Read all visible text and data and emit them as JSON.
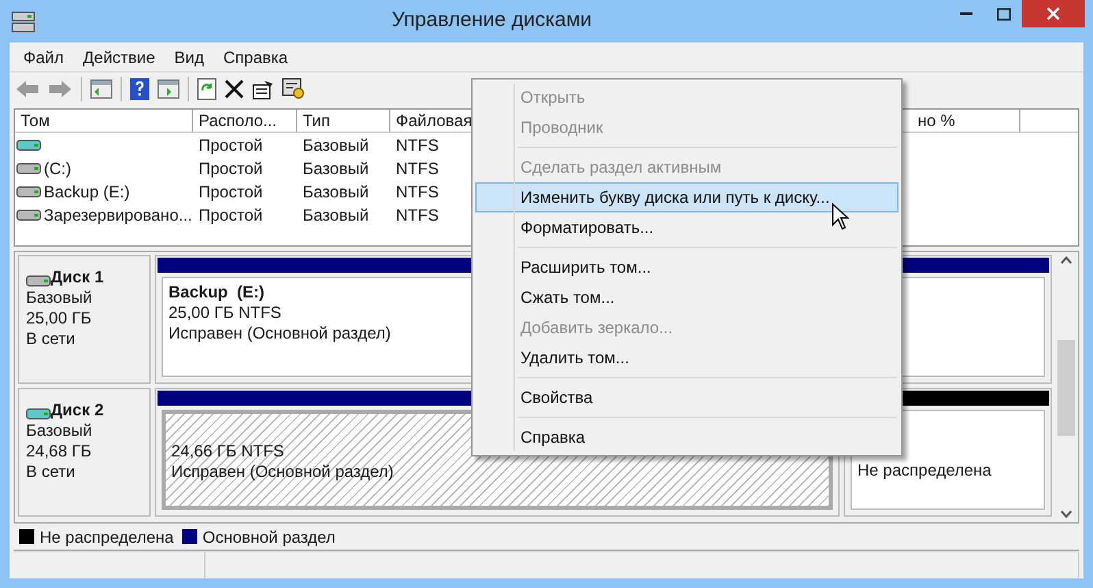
{
  "window": {
    "title": "Управление дисками"
  },
  "menu_bar": [
    "Файл",
    "Действие",
    "Вид",
    "Справка"
  ],
  "table": {
    "columns": [
      "Том",
      "Располо...",
      "Тип",
      "Файловая",
      "но %"
    ],
    "rows": [
      {
        "volume": "",
        "layout": "Простой",
        "type": "Базовый",
        "fs": "NTFS"
      },
      {
        "volume": "(C:)",
        "layout": "Простой",
        "type": "Базовый",
        "fs": "NTFS"
      },
      {
        "volume": "Backup (E:)",
        "layout": "Простой",
        "type": "Базовый",
        "fs": "NTFS"
      },
      {
        "volume": "Зарезервировано...",
        "layout": "Простой",
        "type": "Базовый",
        "fs": "NTFS"
      }
    ]
  },
  "disks": [
    {
      "name": "Диск 1",
      "type": "Базовый",
      "size": "25,00 ГБ",
      "status": "В сети",
      "partitions": [
        {
          "kind": "primary",
          "title": "Backup  (E:)",
          "size": "25,00 ГБ NTFS",
          "state": "Исправен (Основной раздел)",
          "selected": false
        }
      ]
    },
    {
      "name": "Диск 2",
      "type": "Базовый",
      "size": "24,68 ГБ",
      "status": "В сети",
      "partitions": [
        {
          "kind": "primary",
          "size": "24,66 ГБ NTFS",
          "state": "Исправен (Основной раздел)",
          "selected": true
        },
        {
          "kind": "unallocated",
          "state": "Не распределена",
          "selected": false
        }
      ]
    }
  ],
  "legend": [
    {
      "label": "Не распределена",
      "color": "#000000"
    },
    {
      "label": "Основной раздел",
      "color": "#000080"
    }
  ],
  "context_menu": [
    {
      "label": "Открыть",
      "disabled": true,
      "highlighted": false,
      "separator_after": false
    },
    {
      "label": "Проводник",
      "disabled": true,
      "highlighted": false,
      "separator_after": true
    },
    {
      "label": "Сделать раздел активным",
      "disabled": true,
      "highlighted": false,
      "separator_after": false
    },
    {
      "label": "Изменить букву диска или путь к диску...",
      "disabled": false,
      "highlighted": true,
      "separator_after": false
    },
    {
      "label": "Форматировать...",
      "disabled": false,
      "highlighted": false,
      "separator_after": true
    },
    {
      "label": "Расширить том...",
      "disabled": false,
      "highlighted": false,
      "separator_after": false
    },
    {
      "label": "Сжать том...",
      "disabled": false,
      "highlighted": false,
      "separator_after": false
    },
    {
      "label": "Добавить зеркало...",
      "disabled": true,
      "highlighted": false,
      "separator_after": false
    },
    {
      "label": "Удалить том...",
      "disabled": false,
      "highlighted": false,
      "separator_after": true
    },
    {
      "label": "Свойства",
      "disabled": false,
      "highlighted": false,
      "separator_after": true
    },
    {
      "label": "Справка",
      "disabled": false,
      "highlighted": false,
      "separator_after": false
    }
  ]
}
